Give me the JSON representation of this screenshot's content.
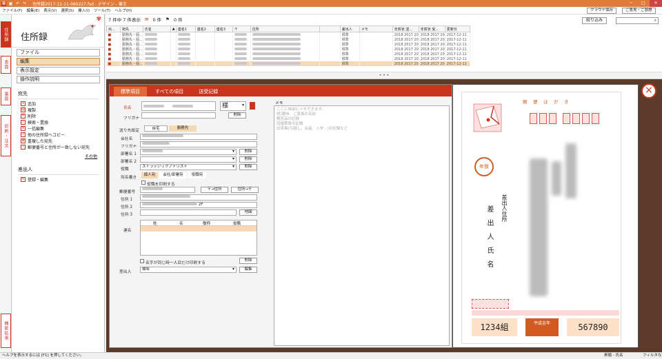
{
  "titlebar": {
    "title": "住所録2017-12-11-060227.fsd - デザイン - 筆王",
    "min": "─",
    "max": "□",
    "close": "✕"
  },
  "menu": {
    "items": [
      "ファイル(F)",
      "編集(E)",
      "表示(V)",
      "選択(S)",
      "挿入(I)",
      "ツール(T)",
      "ヘルプ(H)"
    ],
    "cloud_save": "クラウド保存",
    "feedback": "ご意見・ご感想"
  },
  "vtabs": {
    "addressbook": "住所録",
    "front": "表面",
    "back": "裏面",
    "print": "印刷・注文",
    "extra": "機能拡張"
  },
  "left": {
    "title": "住所録",
    "nav": [
      "ファイル",
      "編集",
      "表示設定",
      "操作説明"
    ],
    "atesaki_header": "宛先",
    "atesaki_items": [
      "追加",
      "複製",
      "削除",
      "検索・置換",
      "一括編集",
      "他の住所録へコピー",
      "重複した宛先",
      "郵便番号と住所が一致しない宛先"
    ],
    "other_link": "その他",
    "sender_header": "差出人",
    "sender_items": [
      "登録・編集"
    ]
  },
  "list": {
    "count_text": "7 件中 7 件表示",
    "mail_count": "0 件",
    "flag_count": "0 件",
    "filter_button": "絞り込み",
    "columns": [
      "出...",
      "宛先",
      "氏名",
      "▲",
      "連名1",
      "連名2",
      "連名3",
      "〒",
      "住所",
      "",
      "差出人",
      "メモ",
      "年賀状 送...",
      "年賀状 受...",
      "更新日"
    ],
    "rows": [
      {
        "atesaki": "勤務先・個...",
        "sender": "標準",
        "sent": "2018 2017 20",
        "recv": "2018 2017 20",
        "updated": "2017-12-11"
      },
      {
        "atesaki": "勤務先・個...",
        "sender": "標準",
        "sent": "2018 2017 20",
        "recv": "2018 2017 20",
        "updated": "2017-12-11"
      },
      {
        "atesaki": "勤務先・個...",
        "sender": "標準",
        "sent": "2018 2017 20",
        "recv": "2018 2017 20",
        "updated": "2017-12-11"
      },
      {
        "atesaki": "勤務先・個...",
        "sender": "標準",
        "sent": "2018 2017 20",
        "recv": "2018 2017 20",
        "updated": "2017-12-11"
      },
      {
        "atesaki": "勤務先・個...",
        "sender": "標準",
        "sent": "2018 2017 20",
        "recv": "2018 2017 20",
        "updated": "2017-12-11"
      },
      {
        "atesaki": "勤務先・個...",
        "sender": "標準",
        "sent": "2018 2017 20",
        "recv": "2018 2017 20",
        "updated": "2017-12-11"
      },
      {
        "atesaki": "勤務先・個...",
        "sender": "標準",
        "sent": "2018 2017 20",
        "recv": "2018 2017 20",
        "updated": "2017-12-11"
      }
    ],
    "splitter": "• • •"
  },
  "editor": {
    "tabs": [
      "標準項目",
      "すべての項目",
      "送受記録"
    ],
    "name_label": "氏名",
    "furigana_label": "フリガナ",
    "honorific": "様",
    "delete_btn": "削除",
    "send_setting_label": "送り先設定",
    "send_home": "自宅",
    "send_work": "勤務先",
    "company_label": "会社名",
    "company_furigana_label": "フリガナ",
    "dept1_label": "部署名 1",
    "dept2_label": "部署名 2",
    "title_label": "役職",
    "title_value": "ストラテジックアナリスト",
    "atena_label": "宛名書き",
    "atena_options": [
      "個人宛",
      "会社/部署宛",
      "役職宛"
    ],
    "print_title_check": "役職を印刷する",
    "zip_label": "郵便番号",
    "zip_to_addr": "〒→住所",
    "addr_to_zip": "住所→〒",
    "addr1_label": "住所 1",
    "addr2_label": "住所 2",
    "addr2_suffix": "2F",
    "addr3_label": "住所 3",
    "map_btn": "地図",
    "renmei_label": "連名",
    "renmei_cols": [
      "姓",
      "名",
      "敬称",
      "役職"
    ],
    "same_surname_check": "名字が同じ時一人目だけ印刷する",
    "sender_label": "差出人",
    "sender_value": "標準",
    "edit_btn": "編集",
    "memo_label": "メモ",
    "memo_placeholder": "ここに自由にメモできます。\n 例)趣味、ご家族の名前\n 贈答品の記録\n 冠婚葬祭の記録\n 出来事(引越し、出産、入学…)の記録など"
  },
  "card": {
    "postal_header": "郵　便　は　が　き",
    "nenga": "年賀",
    "sender_address": "差出人住所",
    "sender_name": "差出人氏名",
    "lottery": "平成吉年",
    "code_left": "1234組",
    "code_right": "567890"
  },
  "status": {
    "left": "ヘルプを表示するには [F1] を押してください。",
    "right1": "昇順 - 氏名",
    "right2": "フィルタなし"
  },
  "colors": {
    "accent": "#c9341c",
    "highlight": "#f7d8b4",
    "titlebar": "#e07b39"
  }
}
